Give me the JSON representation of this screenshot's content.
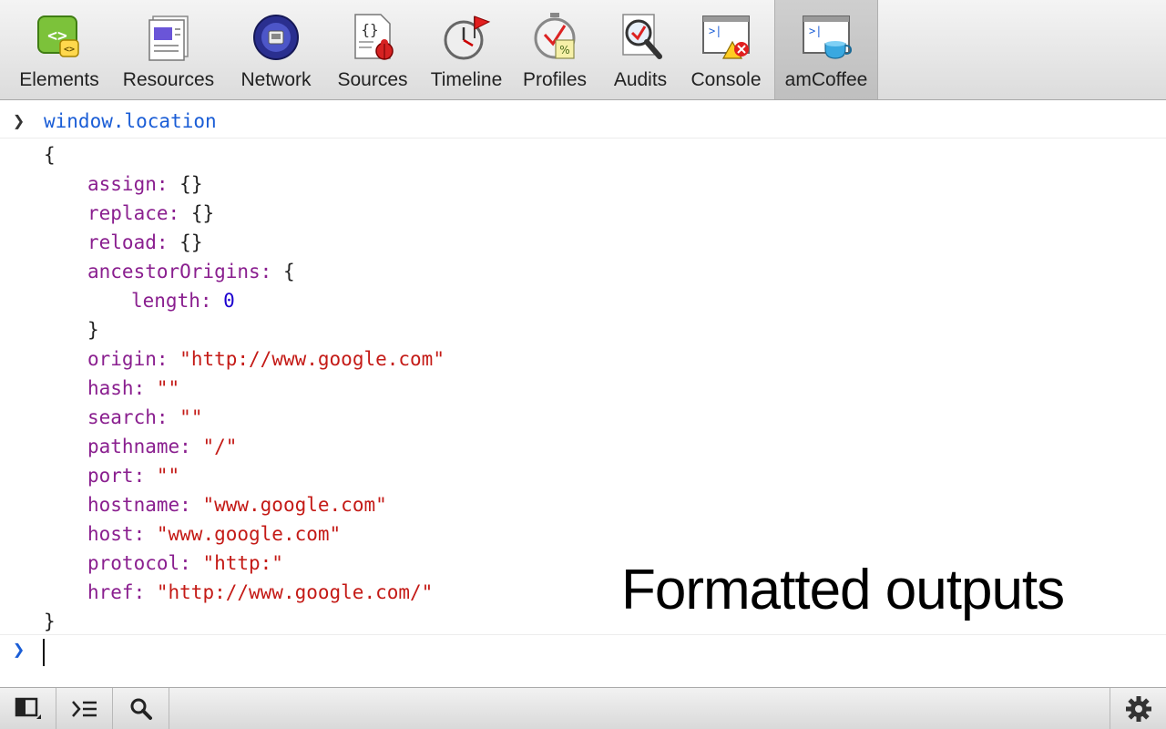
{
  "toolbar": {
    "tabs": [
      {
        "label": "Elements",
        "icon": "elements-icon",
        "active": false
      },
      {
        "label": "Resources",
        "icon": "resources-icon",
        "active": false
      },
      {
        "label": "Network",
        "icon": "network-icon",
        "active": false
      },
      {
        "label": "Sources",
        "icon": "sources-icon",
        "active": false
      },
      {
        "label": "Timeline",
        "icon": "timeline-icon",
        "active": false
      },
      {
        "label": "Profiles",
        "icon": "profiles-icon",
        "active": false
      },
      {
        "label": "Audits",
        "icon": "audits-icon",
        "active": false
      },
      {
        "label": "Console",
        "icon": "console-icon",
        "active": false
      },
      {
        "label": "amCoffee",
        "icon": "amcoffee-icon",
        "active": true
      }
    ]
  },
  "console": {
    "prompt_symbol": "❯",
    "command": "window.location",
    "output": {
      "open_brace": "{",
      "close_brace": "}",
      "assign": {
        "key": "assign:",
        "value": "{}"
      },
      "replace": {
        "key": "replace:",
        "value": "{}"
      },
      "reload": {
        "key": "reload:",
        "value": "{}"
      },
      "ancestorOrigins": {
        "key": "ancestorOrigins:",
        "open": "{",
        "close": "}",
        "length": {
          "key": "length:",
          "value": "0"
        }
      },
      "origin": {
        "key": "origin:",
        "value": "\"http://www.google.com\""
      },
      "hash": {
        "key": "hash:",
        "value": "\"\""
      },
      "search": {
        "key": "search:",
        "value": "\"\""
      },
      "pathname": {
        "key": "pathname:",
        "value": "\"/\""
      },
      "port": {
        "key": "port:",
        "value": "\"\""
      },
      "hostname": {
        "key": "hostname:",
        "value": "\"www.google.com\""
      },
      "host": {
        "key": "host:",
        "value": "\"www.google.com\""
      },
      "protocol": {
        "key": "protocol:",
        "value": "\"http:\""
      },
      "href": {
        "key": "href:",
        "value": "\"http://www.google.com/\""
      }
    },
    "input_prompt_symbol": "❯",
    "input_value": ""
  },
  "overlay_caption": "Formatted outputs",
  "statusbar": {
    "buttons": [
      "dock-icon",
      "console-drawer-icon",
      "search-icon"
    ],
    "settings": "gear-icon"
  },
  "colors": {
    "command": "#1a5dd6",
    "key": "#8a1f8f",
    "string": "#c41a16",
    "number": "#1c00cf",
    "input_prompt": "#1a5dd6"
  }
}
